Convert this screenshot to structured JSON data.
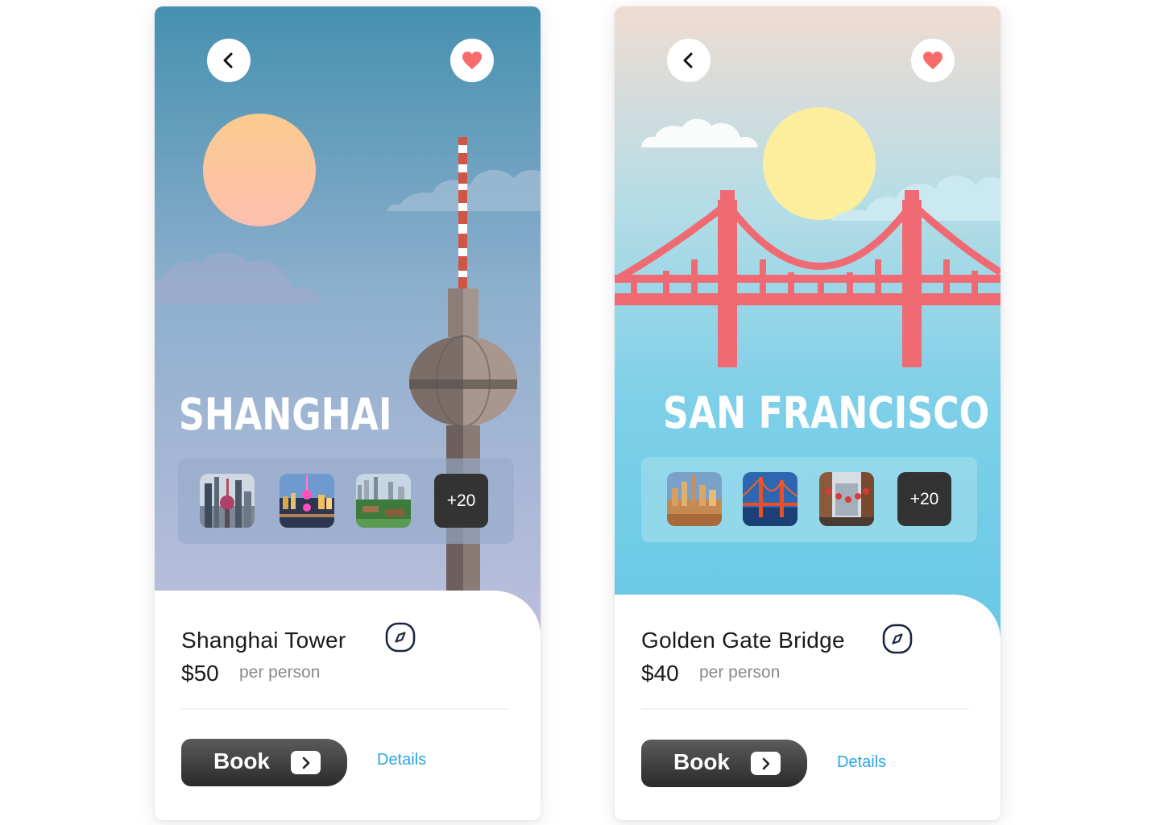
{
  "cards": [
    {
      "id": "shanghai",
      "city": "SHANGHAI",
      "extra_photos": "+20",
      "place": "Shanghai Tower",
      "price": "$50",
      "price_unit": "per person",
      "book_label": "Book",
      "details_label": "Details",
      "icons": {
        "back": "chevron-left-icon",
        "favorite": "heart-icon",
        "location": "compass-icon",
        "book_arrow": "chevron-right-icon"
      },
      "colors": {
        "sky_top": "#4690b0",
        "sky_bottom": "#b9bcdc",
        "sun": "#fcc5a0",
        "heart": "#f96b6b"
      }
    },
    {
      "id": "san-francisco",
      "city": "SAN FRANCISCO",
      "extra_photos": "+20",
      "place": "Golden Gate Bridge",
      "price": "$40",
      "price_unit": "per person",
      "book_label": "Book",
      "details_label": "Details",
      "icons": {
        "back": "chevron-left-icon",
        "favorite": "heart-icon",
        "location": "compass-icon",
        "book_arrow": "chevron-right-icon"
      },
      "colors": {
        "sky_top": "#f2dcd2",
        "sky_bottom": "#6ccbe7",
        "sun": "#fdee9e",
        "bridge": "#f06a74",
        "heart": "#f96b6b"
      }
    }
  ]
}
